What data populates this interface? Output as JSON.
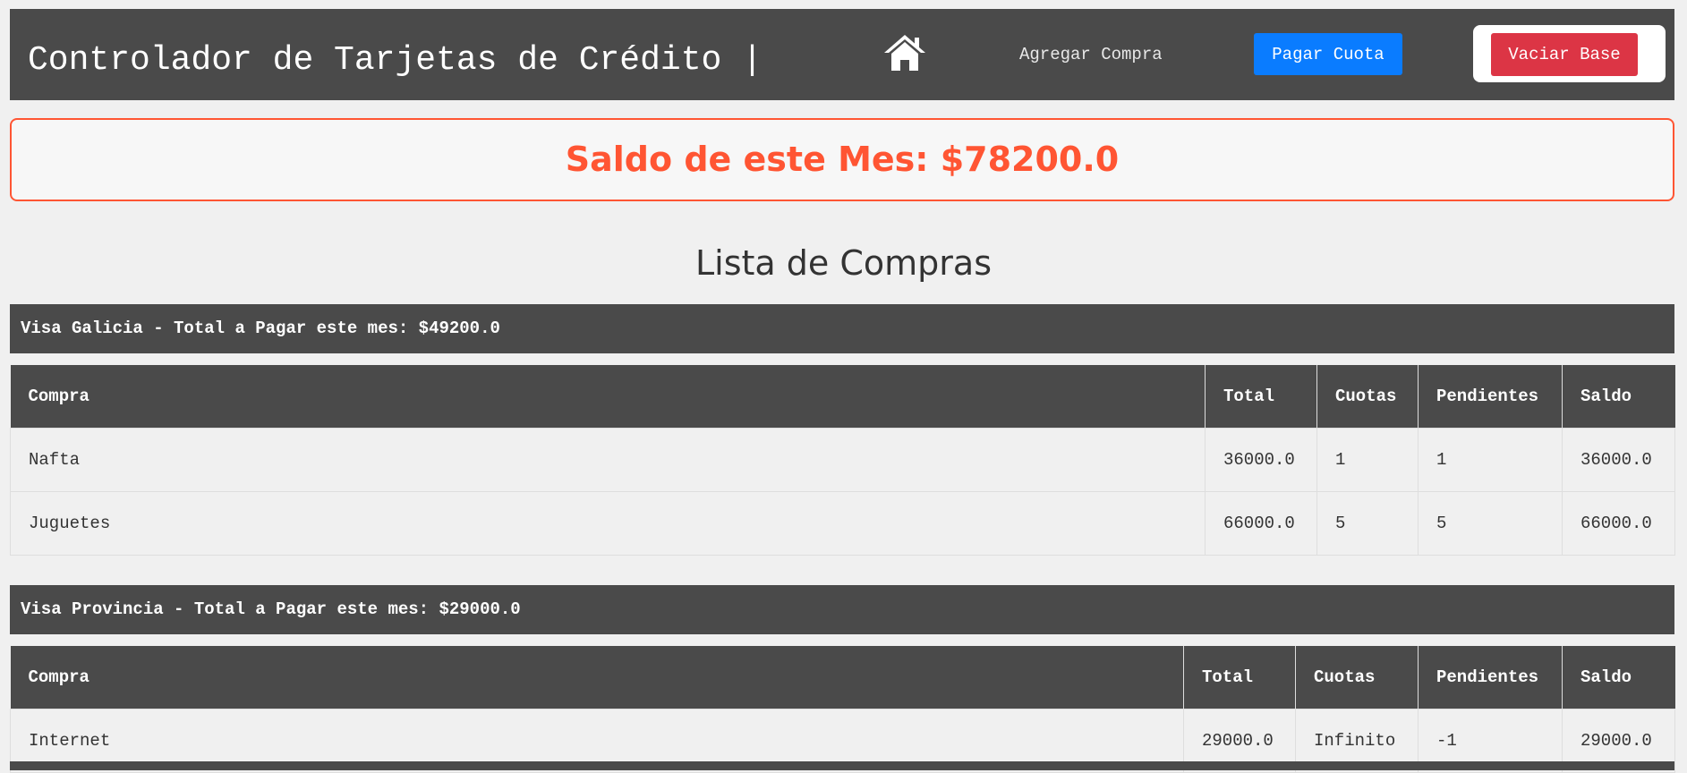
{
  "header": {
    "title": "Controlador de Tarjetas de Crédito |",
    "nav": {
      "home_icon": "home-icon",
      "add_purchase": "Agregar Compra",
      "pay_installment": "Pagar Cuota",
      "empty_database": "Vaciar Base"
    }
  },
  "balance": {
    "text": "Saldo de este Mes: $78200.0"
  },
  "purchases_title": "Lista de Compras",
  "columns": [
    "Compra",
    "Total",
    "Cuotas",
    "Pendientes",
    "Saldo"
  ],
  "cards": [
    {
      "title": "Visa Galicia - Total a Pagar este mes: $49200.0",
      "rows": [
        [
          "Nafta",
          "36000.0",
          "1",
          "1",
          "36000.0"
        ],
        [
          "Juguetes",
          "66000.0",
          "5",
          "5",
          "66000.0"
        ]
      ]
    },
    {
      "title": "Visa Provincia - Total a Pagar este mes: $29000.0",
      "rows": [
        [
          "Internet",
          "29000.0",
          "Infinito",
          "-1",
          "29000.0"
        ]
      ]
    }
  ],
  "colors": {
    "header_bg": "#4a4a4a",
    "page_bg": "#f0f0f0",
    "accent_balance": "#ff5533",
    "primary_button": "#0a7cff",
    "danger_button": "#dc3545"
  }
}
